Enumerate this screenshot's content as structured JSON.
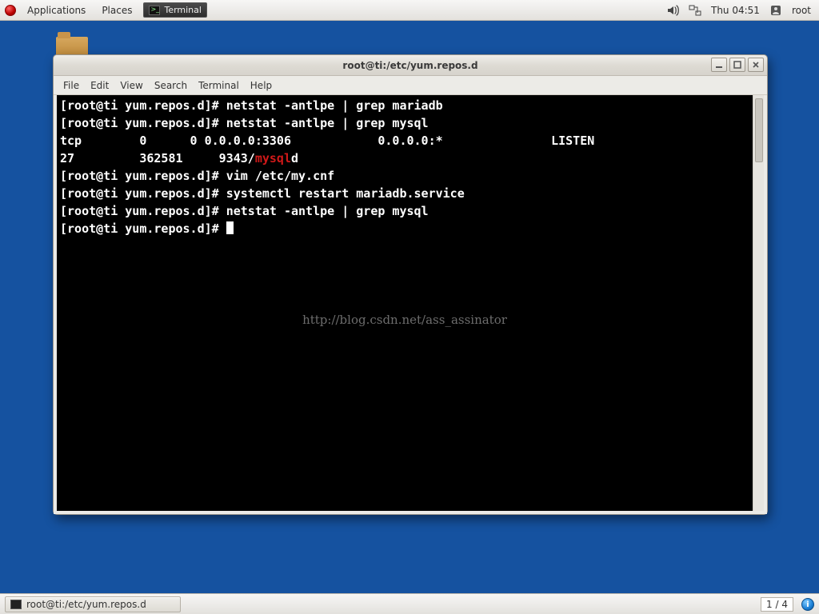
{
  "panel": {
    "applications": "Applications",
    "places": "Places",
    "taskbar_app": "Terminal",
    "clock": "Thu 04:51",
    "user": "root"
  },
  "window": {
    "title": "root@ti:/etc/yum.repos.d",
    "menu": {
      "file": "File",
      "edit": "Edit",
      "view": "View",
      "search": "Search",
      "terminal": "Terminal",
      "help": "Help"
    }
  },
  "terminal": {
    "prompt": "[root@ti yum.repos.d]# ",
    "lines": {
      "l0": "[root@ti yum.repos.d]# netstat -antlpe | grep mariadb",
      "l1": "[root@ti yum.repos.d]# netstat -antlpe | grep mysql",
      "l2": "tcp        0      0 0.0.0.0:3306            0.0.0.0:*               LISTEN     ",
      "l3a": "27         362581     9343/",
      "l3b": "mysql",
      "l3c": "d           ",
      "l4": "[root@ti yum.repos.d]# vim /etc/my.cnf",
      "l5": "[root@ti yum.repos.d]# systemctl restart mariadb.service",
      "l6": "[root@ti yum.repos.d]# netstat -antlpe | grep mysql",
      "l7": "[root@ti yum.repos.d]# "
    },
    "watermark": "http://blog.csdn.net/ass_assinator"
  },
  "bottom": {
    "task_label": "root@ti:/etc/yum.repos.d",
    "workspace": "1 / 4"
  }
}
